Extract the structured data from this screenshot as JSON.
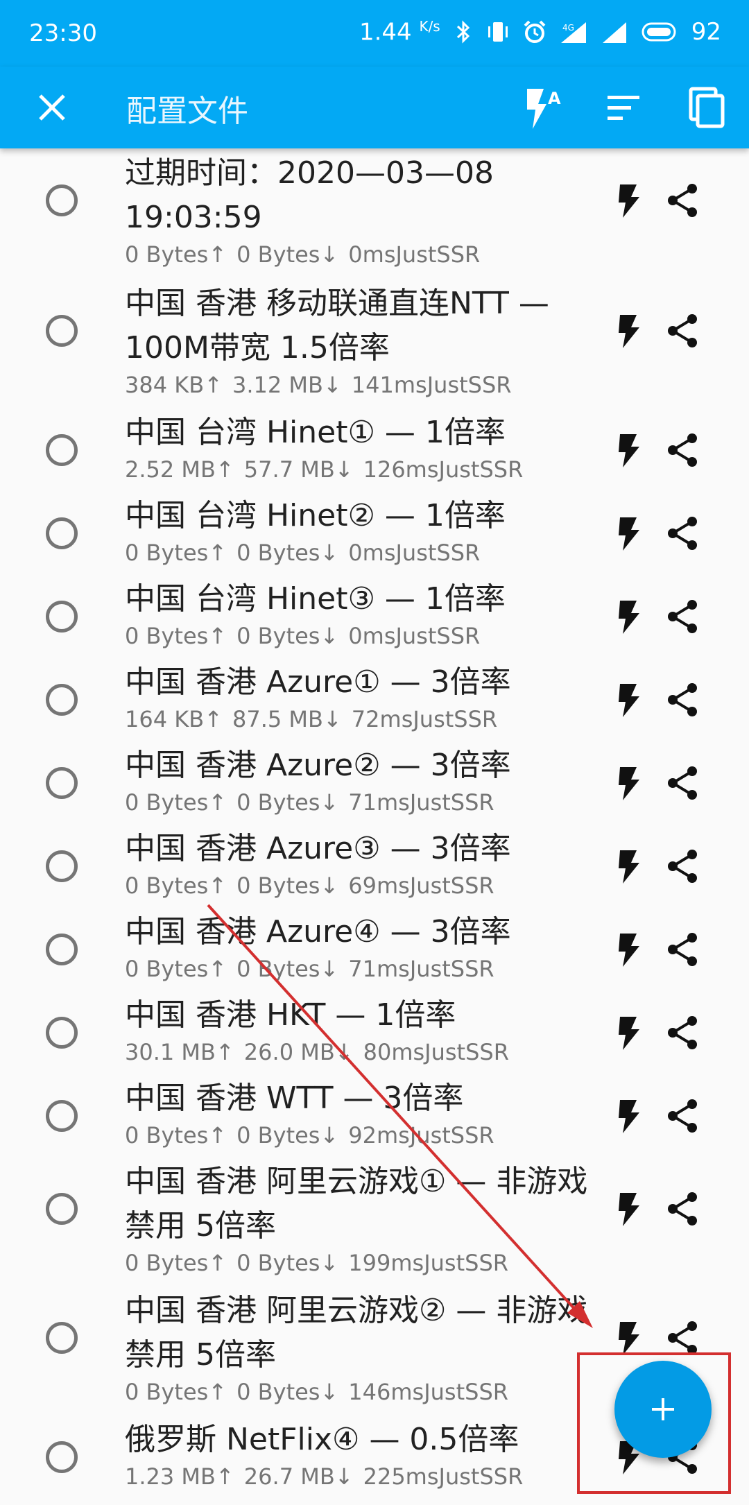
{
  "status_bar": {
    "time": "23:30",
    "net_speed": "1.44",
    "speed_unit": "K/s",
    "network": "4G",
    "battery": "92"
  },
  "app_bar": {
    "title": "配置文件",
    "close_icon": "close-icon",
    "actions": [
      "flash-auto-icon",
      "sort-icon",
      "copy-icon"
    ]
  },
  "profiles": [
    {
      "name": "过期时间：2020—03—08 19:03:59",
      "up": "0 Bytes↑",
      "down": "0 Bytes↓",
      "latency": "0ms",
      "provider": "JustSSR"
    },
    {
      "name": "中国 香港 移动联通直连NTT — 100M带宽 1.5倍率",
      "up": "384 KB↑",
      "down": "3.12 MB↓",
      "latency": "141ms",
      "provider": "JustSSR"
    },
    {
      "name": "中国 台湾 Hinet① — 1倍率",
      "up": "2.52 MB↑",
      "down": "57.7 MB↓",
      "latency": "126ms",
      "provider": "JustSSR"
    },
    {
      "name": "中国 台湾 Hinet② — 1倍率",
      "up": "0 Bytes↑",
      "down": "0 Bytes↓",
      "latency": "0ms",
      "provider": "JustSSR"
    },
    {
      "name": "中国 台湾 Hinet③ — 1倍率",
      "up": "0 Bytes↑",
      "down": "0 Bytes↓",
      "latency": "0ms",
      "provider": "JustSSR"
    },
    {
      "name": "中国 香港 Azure① — 3倍率",
      "up": "164 KB↑",
      "down": "87.5 MB↓",
      "latency": "72ms",
      "provider": "JustSSR"
    },
    {
      "name": "中国 香港 Azure② — 3倍率",
      "up": "0 Bytes↑",
      "down": "0 Bytes↓",
      "latency": "71ms",
      "provider": "JustSSR"
    },
    {
      "name": "中国 香港 Azure③ — 3倍率",
      "up": "0 Bytes↑",
      "down": "0 Bytes↓",
      "latency": "69ms",
      "provider": "JustSSR"
    },
    {
      "name": "中国 香港 Azure④ — 3倍率",
      "up": "0 Bytes↑",
      "down": "0 Bytes↓",
      "latency": "71ms",
      "provider": "JustSSR"
    },
    {
      "name": "中国 香港 HKT — 1倍率",
      "up": "30.1 MB↑",
      "down": "26.0 MB↓",
      "latency": "80ms",
      "provider": "JustSSR"
    },
    {
      "name": "中国 香港 WTT — 3倍率",
      "up": "0 Bytes↑",
      "down": "0 Bytes↓",
      "latency": "92ms",
      "provider": "JustSSR"
    },
    {
      "name": "中国 香港 阿里云游戏① — 非游戏禁用 5倍率",
      "up": "0 Bytes↑",
      "down": "0 Bytes↓",
      "latency": "199ms",
      "provider": "JustSSR"
    },
    {
      "name": "中国 香港 阿里云游戏② — 非游戏禁用 5倍率",
      "up": "0 Bytes↑",
      "down": "0 Bytes↓",
      "latency": "146ms",
      "provider": "JustSSR"
    },
    {
      "name": "俄罗斯 NetFlix④ — 0.5倍率",
      "up": "1.23 MB↑",
      "down": "26.7 MB↓",
      "latency": "225ms",
      "provider": "JustSSR"
    }
  ],
  "fab": {
    "icon": "plus-icon"
  },
  "annotation": {
    "color": "#D32F2F"
  }
}
